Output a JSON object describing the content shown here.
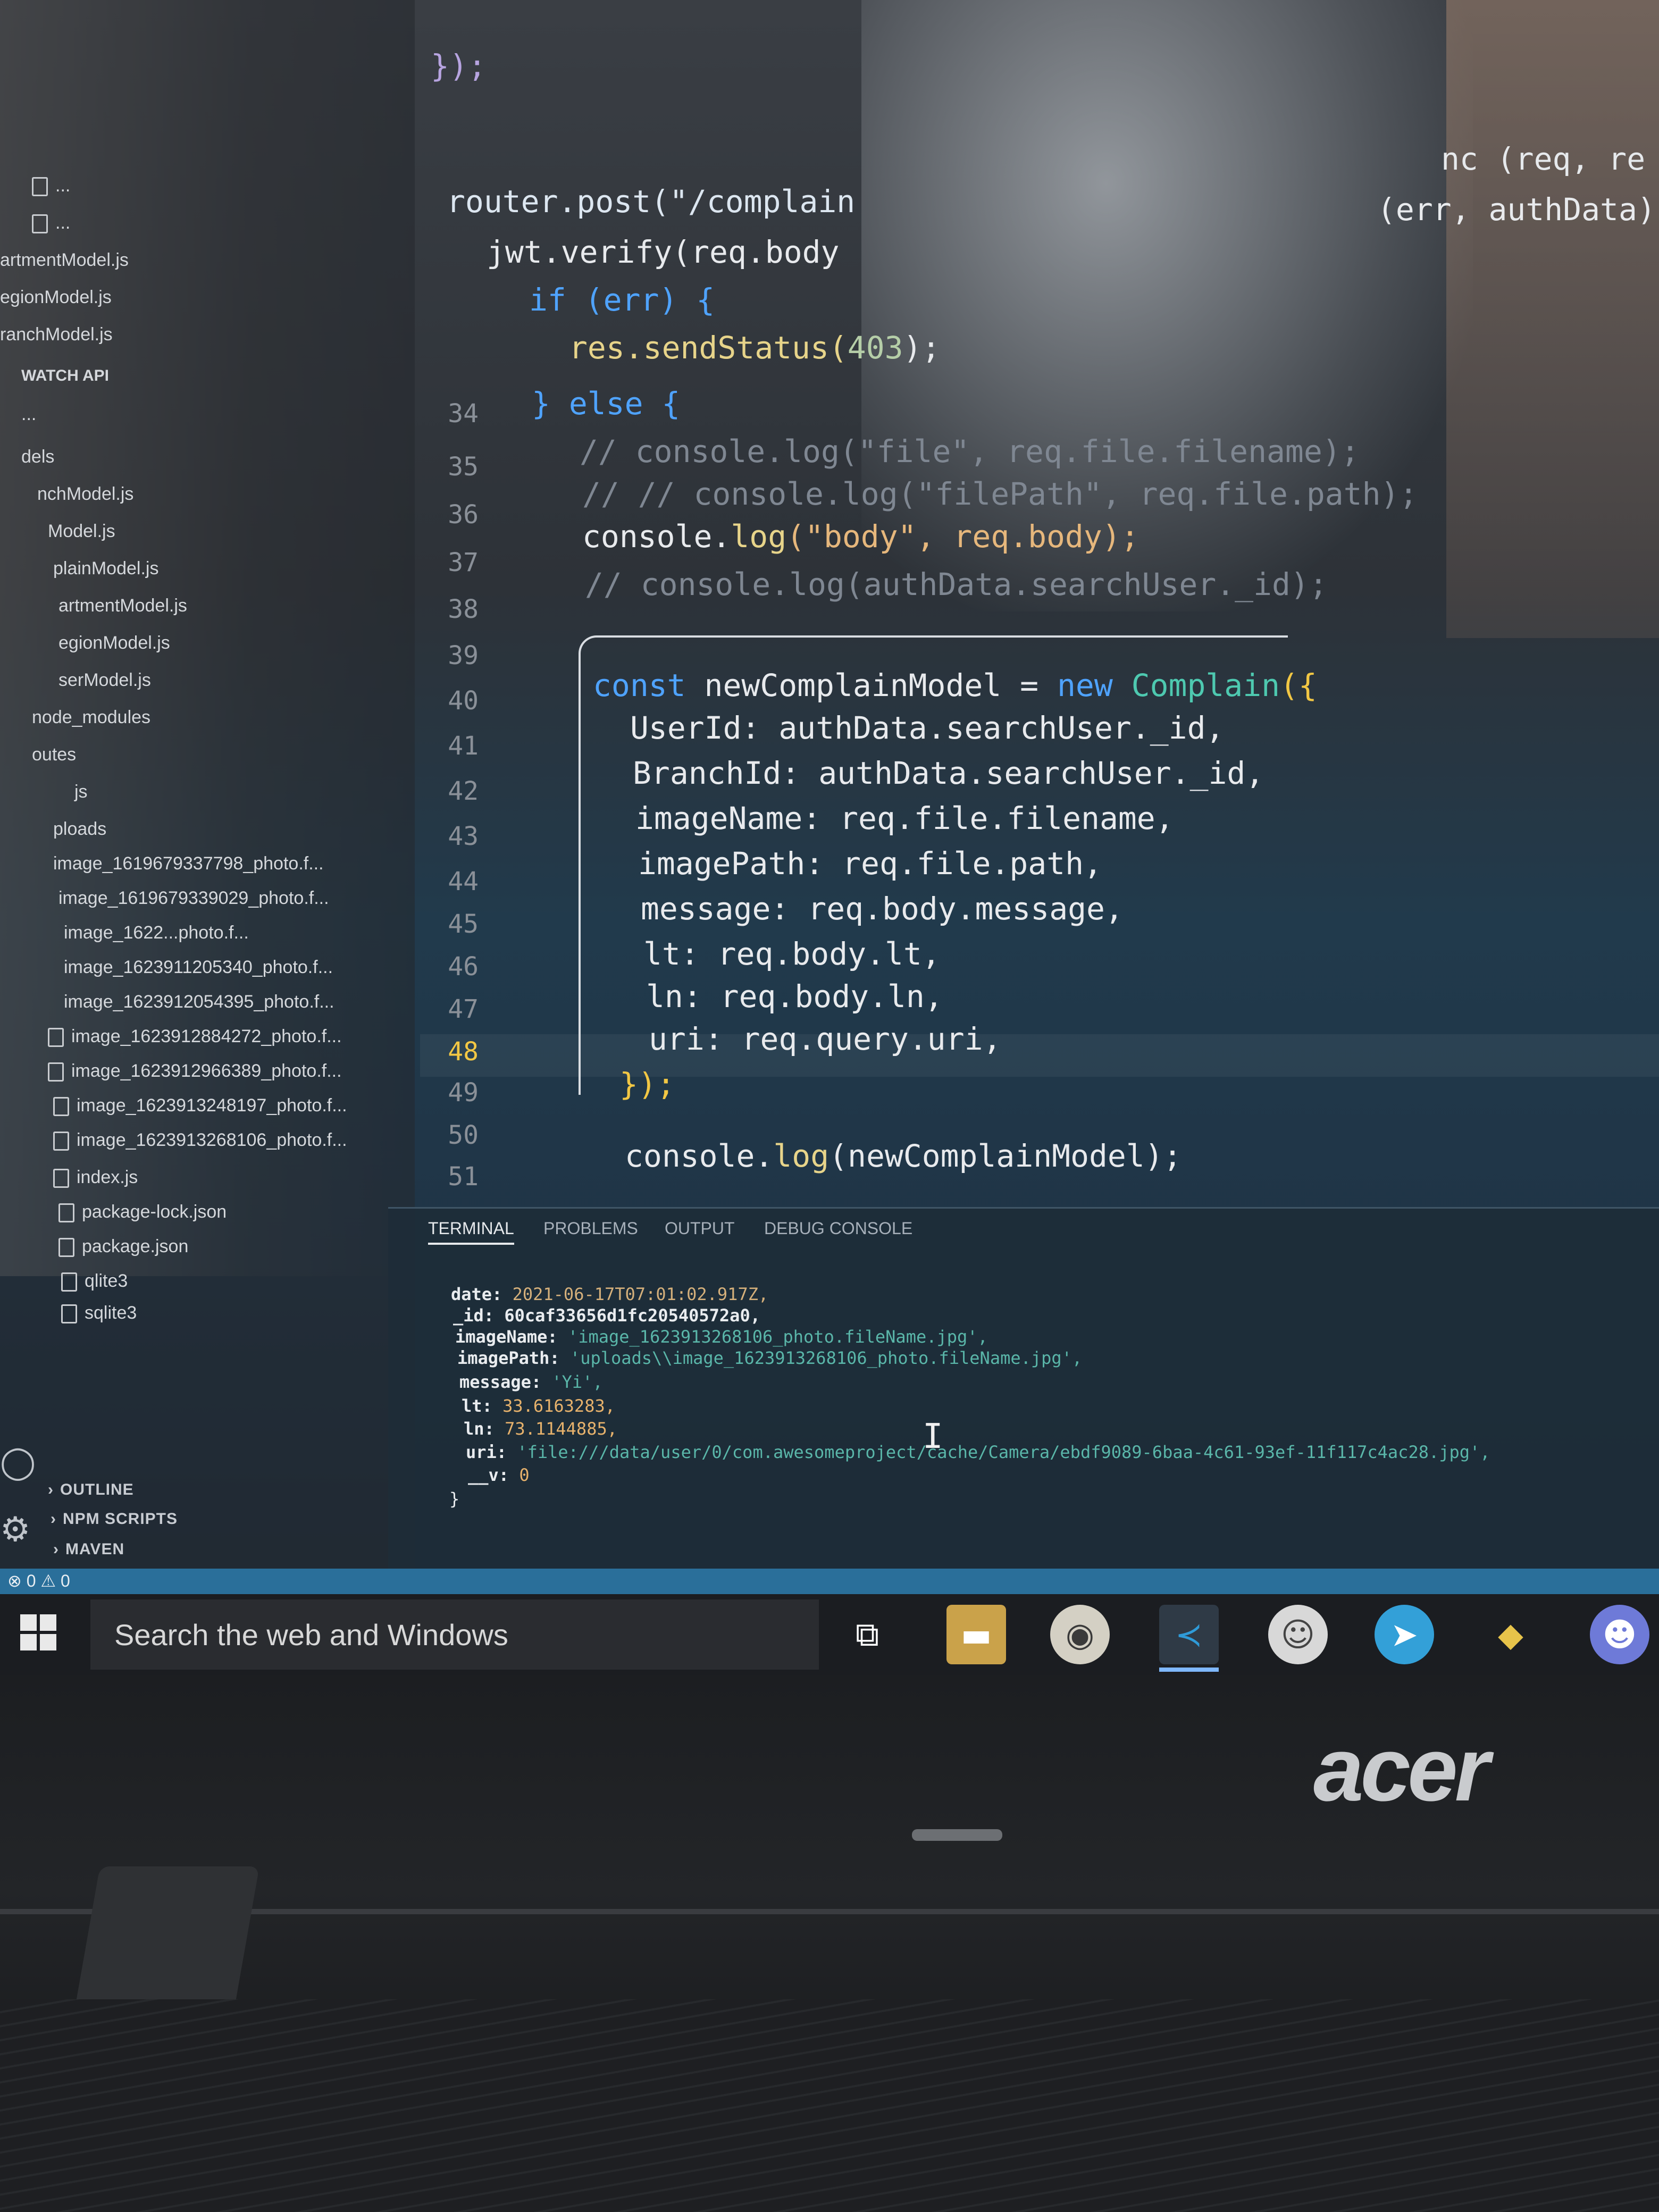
{
  "explorer": {
    "items": [
      {
        "label": "...",
        "icon": "js-file-icon"
      },
      {
        "label": "...",
        "icon": "js-file-icon"
      },
      {
        "label": "artmentModel.js",
        "icon": "js-file-icon"
      },
      {
        "label": "egionModel.js",
        "icon": "js-file-icon"
      },
      {
        "label": "ranchModel.js",
        "icon": "js-file-icon"
      },
      {
        "label": "WATCH API",
        "icon": "folder-icon"
      },
      {
        "label": "...",
        "icon": "folder-icon"
      },
      {
        "label": "dels",
        "icon": "folder-icon"
      },
      {
        "label": "nchModel.js",
        "icon": "js-file-icon"
      },
      {
        "label": "Model.js",
        "icon": "js-file-icon"
      },
      {
        "label": "plainModel.js",
        "icon": "js-file-icon"
      },
      {
        "label": "artmentModel.js",
        "icon": "js-file-icon"
      },
      {
        "label": "egionModel.js",
        "icon": "js-file-icon"
      },
      {
        "label": "serModel.js",
        "icon": "js-file-icon"
      },
      {
        "label": "node_modules",
        "icon": "folder-icon"
      },
      {
        "label": "outes",
        "icon": "folder-icon"
      },
      {
        "label": "js",
        "icon": "js-file-icon"
      },
      {
        "label": "ploads",
        "icon": "folder-icon"
      },
      {
        "label": "image_1619679337798_photo.f...",
        "icon": "image-file-icon"
      },
      {
        "label": "image_1619679339029_photo.f...",
        "icon": "image-file-icon"
      },
      {
        "label": "image_1622...photo.f...",
        "icon": "image-file-icon"
      },
      {
        "label": "image_1623911205340_photo.f...",
        "icon": "image-file-icon"
      },
      {
        "label": "image_1623912054395_photo.f...",
        "icon": "image-file-icon"
      },
      {
        "label": "image_1623912884272_photo.f...",
        "icon": "image-file-icon"
      },
      {
        "label": "image_1623912966389_photo.f...",
        "icon": "image-file-icon"
      },
      {
        "label": "image_1623913248197_photo.f...",
        "icon": "image-file-icon"
      },
      {
        "label": "image_1623913268106_photo.f...",
        "icon": "image-file-icon"
      },
      {
        "label": "index.js",
        "icon": "js-file-icon"
      },
      {
        "label": "package-lock.json",
        "icon": "json-file-icon"
      },
      {
        "label": "package.json",
        "icon": "json-file-icon"
      },
      {
        "label": "qlite3",
        "icon": "file-icon"
      },
      {
        "label": "sqlite3",
        "icon": "file-icon"
      }
    ],
    "sections": [
      "OUTLINE",
      "NPM SCRIPTS",
      "MAVEN"
    ]
  },
  "editor": {
    "line_numbers": [
      "34",
      "35",
      "36",
      "37",
      "38",
      "39",
      "40",
      "41",
      "42",
      "43",
      "44",
      "45",
      "46",
      "47",
      "48",
      "49",
      "50",
      "51"
    ],
    "active_line": "48",
    "code": {
      "l0": "});",
      "l1a": "router.post(\"/complain",
      "l1b": "nc (req, re",
      "l2a": "jwt.verify(req.body",
      "l2b": "(err, authData)",
      "l3": "if (err) {",
      "l4a": "res.sendStatus(",
      "l4b": "403",
      "l4c": ");",
      "l5": "} else {",
      "l6": "// console.log(\"file\", req.file.filename);",
      "l7": "// // console.log(\"filePath\", req.file.path);",
      "l8a": "console.",
      "l8b": "log",
      "l8c": "(\"body\", req.body);",
      "l9": "// console.log(authData.searchUser._id);",
      "l10a": "const",
      "l10b": " newComplainModel = ",
      "l10c": "new",
      "l10d": " Complain",
      "l10e": "({",
      "l11": "UserId: authData.searchUser._id,",
      "l12": "BranchId: authData.searchUser._id,",
      "l13": "imageName: req.file.filename,",
      "l14": "imagePath: req.file.path,",
      "l15": "message: req.body.message,",
      "l16": "lt: req.body.lt,",
      "l17": "ln: req.body.ln,",
      "l18": "uri: req.query.uri,",
      "l19": "});",
      "l20a": "console.",
      "l20b": "log",
      "l20c": "(newComplainModel);"
    }
  },
  "panel": {
    "tabs": [
      "TERMINAL",
      "PROBLEMS",
      "OUTPUT",
      "DEBUG CONSOLE"
    ],
    "active_tab": "TERMINAL",
    "terminal": {
      "date_key": "date:",
      "date_val": "2021-06-17T07:01:02.917Z,",
      "id_key": "_id:",
      "id_val": "60caf33656d1fc20540572a0,",
      "imageName_key": "imageName:",
      "imageName_val": "'image_1623913268106_photo.fileName.jpg',",
      "imagePath_key": "imagePath:",
      "imagePath_val": "'uploads\\\\image_1623913268106_photo.fileName.jpg',",
      "message_key": "message:",
      "message_val": "'Yi',",
      "lt_key": "lt:",
      "lt_val": "33.6163283,",
      "ln_key": "ln:",
      "ln_val": "73.1144885,",
      "uri_key": "uri:",
      "uri_val": "'file:///data/user/0/com.awesomeproject/cache/Camera/ebdf9089-6baa-4c61-93ef-11f117c4ac28.jpg',",
      "v_key": "__v:",
      "v_val": "0",
      "close": "}"
    }
  },
  "statusbar": {
    "text": "⊗ 0 ⚠ 0"
  },
  "taskbar": {
    "search_placeholder": "Search the web and Windows",
    "apps": [
      {
        "name": "task-view-icon"
      },
      {
        "name": "file-explorer-icon"
      },
      {
        "name": "chrome-icon"
      },
      {
        "name": "vscode-icon"
      },
      {
        "name": "chat-app-icon"
      },
      {
        "name": "telegram-icon"
      },
      {
        "name": "binance-icon"
      },
      {
        "name": "discord-icon"
      }
    ]
  },
  "laptop": {
    "brand": "acer"
  }
}
